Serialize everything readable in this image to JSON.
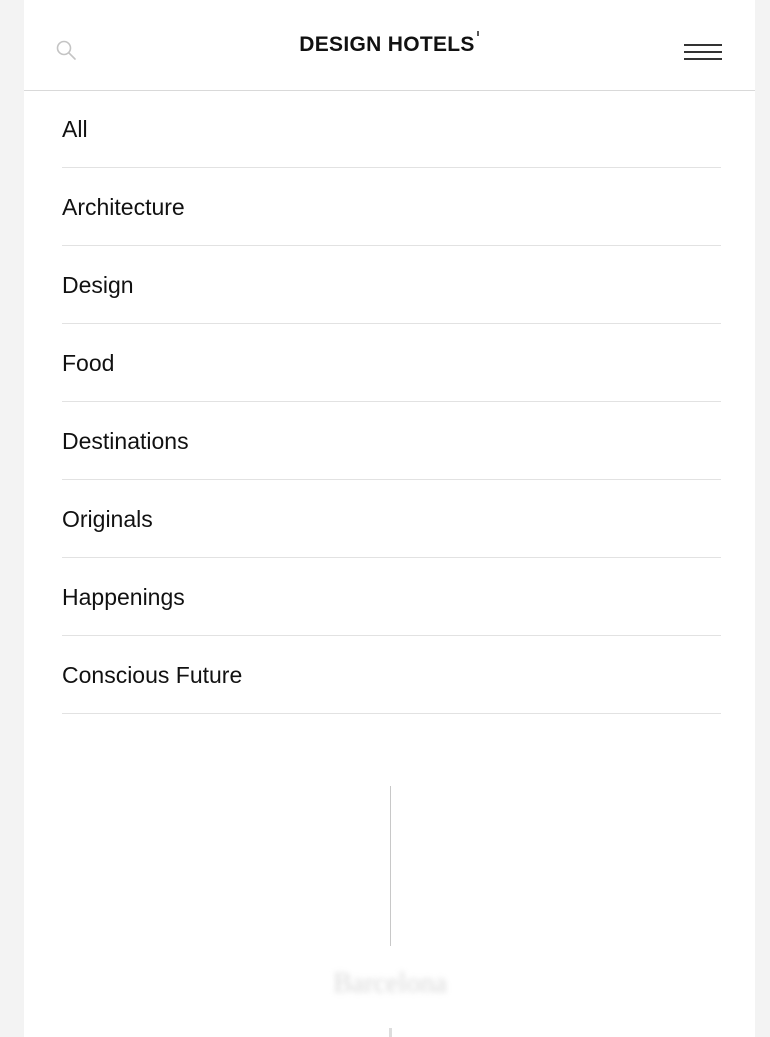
{
  "header": {
    "logo_text": "DESIGN HOTELS",
    "search_icon": "search-icon",
    "menu_icon": "hamburger-menu-icon"
  },
  "nav": {
    "items": [
      {
        "label": "All"
      },
      {
        "label": "Architecture"
      },
      {
        "label": "Design"
      },
      {
        "label": "Food"
      },
      {
        "label": "Destinations"
      },
      {
        "label": "Originals"
      },
      {
        "label": "Happenings"
      },
      {
        "label": "Conscious Future"
      }
    ]
  },
  "background": {
    "caption": "Barcelona"
  },
  "colors": {
    "text": "#111111",
    "divider": "#e2e2e2",
    "background": "#ffffff"
  }
}
